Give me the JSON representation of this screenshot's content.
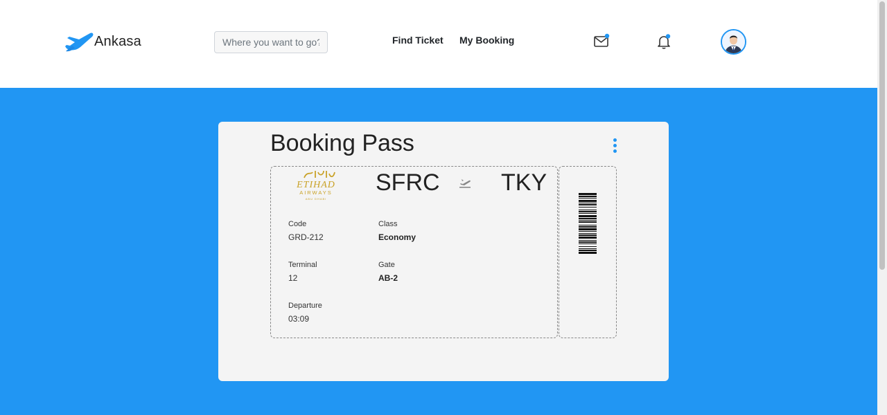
{
  "brand": {
    "name": "Ankasa",
    "accent": "#2196f3"
  },
  "search": {
    "placeholder": "Where you want to go?",
    "value": ""
  },
  "nav": {
    "find_ticket": "Find Ticket",
    "my_booking": "My Booking"
  },
  "icons": {
    "mail": "mail-icon",
    "bell": "bell-icon",
    "avatar": "user-avatar"
  },
  "pass": {
    "title": "Booking Pass",
    "airline_logo": "etihad-airways-logo",
    "from": "SFRC",
    "to": "TKY",
    "fields": {
      "code_label": "Code",
      "code_value": "GRD-212",
      "class_label": "Class",
      "class_value": "Economy",
      "terminal_label": "Terminal",
      "terminal_value": "12",
      "gate_label": "Gate",
      "gate_value": "AB-2",
      "departure_label": "Departure",
      "departure_value": "03:09"
    }
  },
  "colors": {
    "background": "#2196f3",
    "card": "#f4f4f4",
    "logo_gold": "#c9a227"
  }
}
